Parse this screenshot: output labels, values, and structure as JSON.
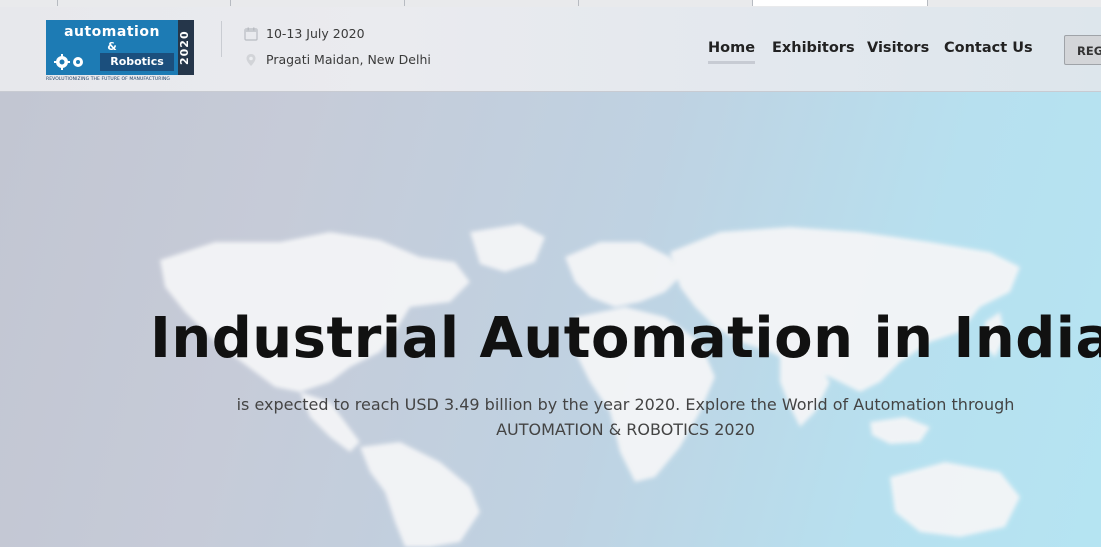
{
  "logo": {
    "top_text": "automation",
    "amp": "&",
    "bottom_text": "Robotics",
    "year": "2020",
    "tagline": "REVOLUTIONIZING THE FUTURE OF MANUFACTURING"
  },
  "event": {
    "dates": "10-13 July 2020",
    "venue": "Pragati Maidan, New Delhi",
    "date_icon": "calendar-icon",
    "venue_icon": "location-pin-icon"
  },
  "nav": {
    "items": [
      "Home",
      "Exhibitors",
      "Visitors",
      "Contact Us"
    ],
    "active": "Home",
    "register_label": "REG"
  },
  "hero": {
    "title": "Industrial Automation in India",
    "subtitle_line1": "is expected to reach USD 3.49 billion by the year 2020. Explore the World of Automation through",
    "subtitle_line2": "AUTOMATION & ROBOTICS 2020"
  },
  "colors": {
    "logo_blue": "#1d7bb4",
    "logo_dark": "#25364a",
    "title": "#111111",
    "subtitle": "#444444",
    "hero_left": "#c2c6d2",
    "hero_right": "#b5e4f2"
  }
}
